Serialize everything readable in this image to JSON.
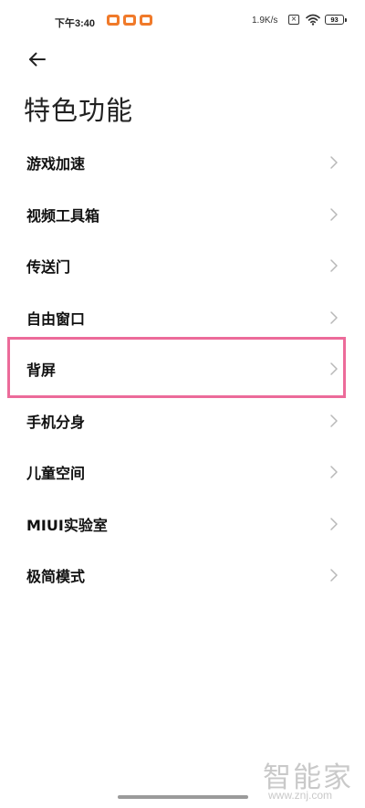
{
  "status_bar": {
    "time": "下午3:40",
    "net_speed": "1.9K/s",
    "sim_label": "×",
    "battery_level": "93",
    "notification_color": "#f07a2a",
    "icons": [
      "notification-icon",
      "notification-icon",
      "notification-icon",
      "sim-icon",
      "wifi-icon",
      "battery-icon"
    ]
  },
  "header": {
    "back_icon": "arrow-left-icon",
    "title": "特色功能"
  },
  "menu": {
    "chevron_icon": "chevron-right-icon",
    "items": [
      {
        "label": "游戏加速"
      },
      {
        "label": "视频工具箱"
      },
      {
        "label": "传送门"
      },
      {
        "label": "自由窗口"
      },
      {
        "label": "背屏",
        "highlighted": true
      },
      {
        "label": "手机分身"
      },
      {
        "label": "儿童空间"
      },
      {
        "label": "MIUI实验室"
      },
      {
        "label": "极简模式"
      }
    ]
  },
  "highlight_color": "#ec6b9a",
  "watermark": {
    "logo_text": "智能家",
    "url": "www.znj.com"
  }
}
